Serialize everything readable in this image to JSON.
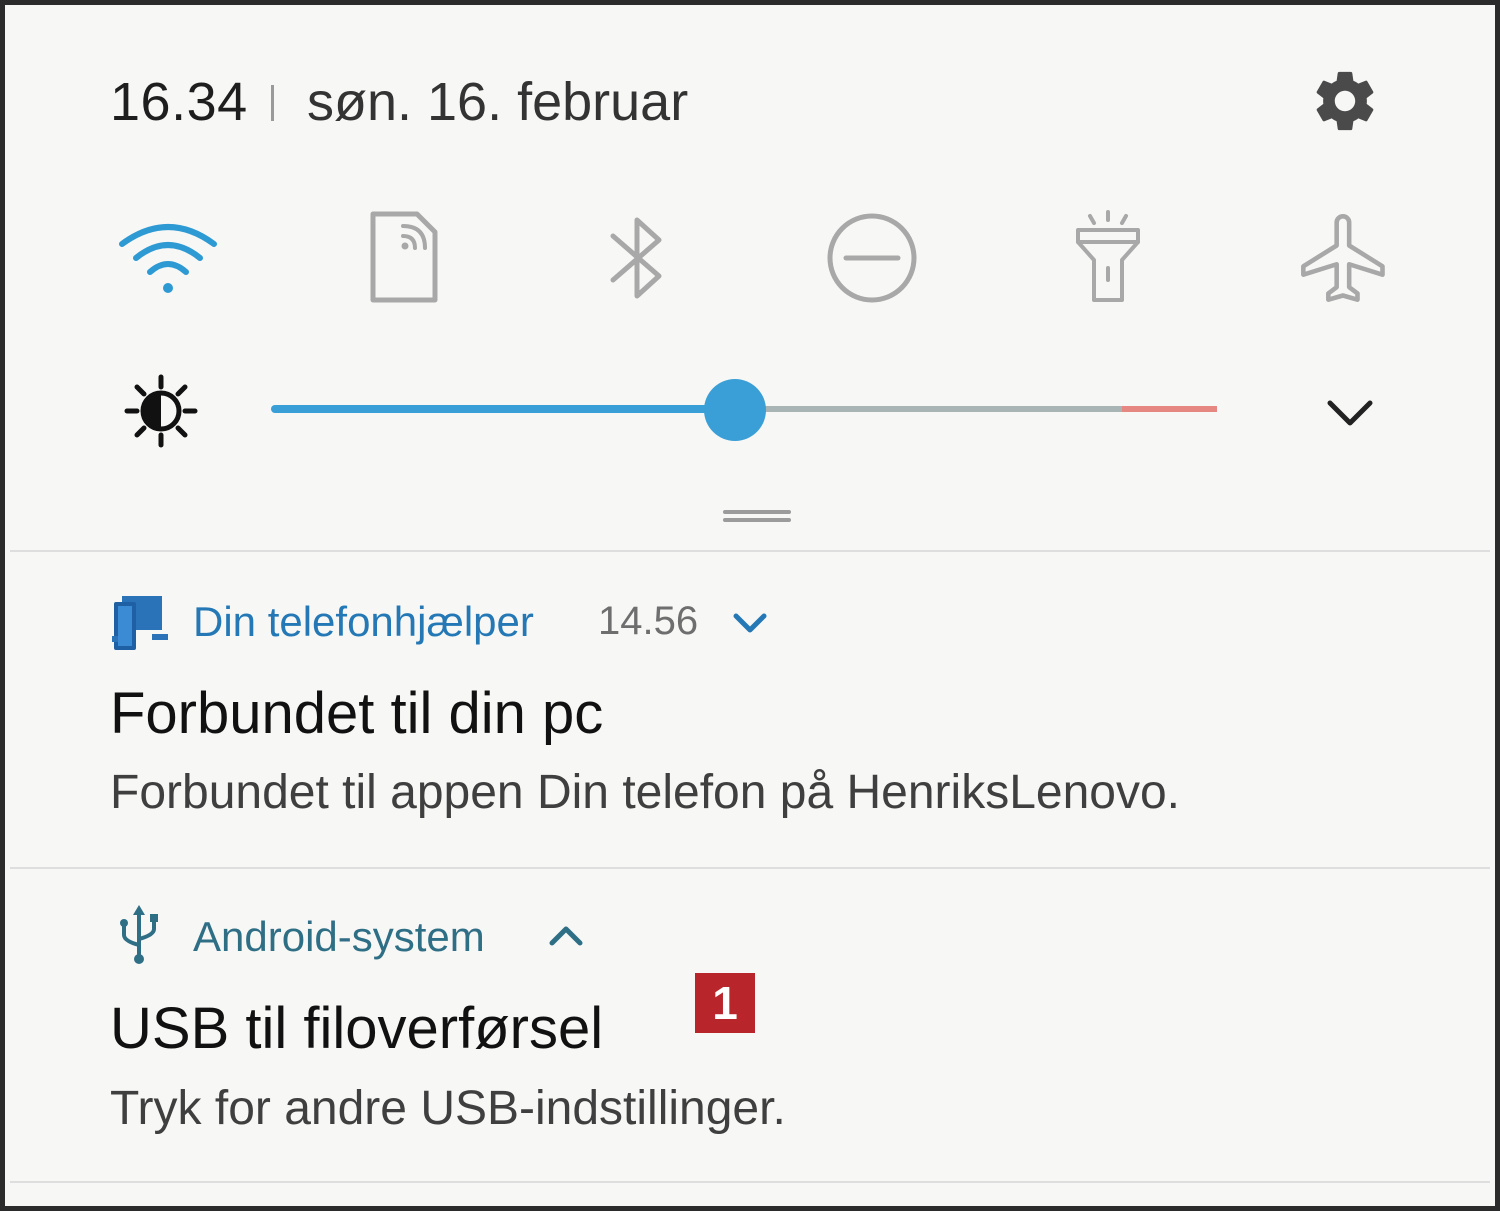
{
  "header": {
    "time": "16.34",
    "date": "søn. 16. februar",
    "settings_icon": "gear-icon"
  },
  "quick_toggles": [
    {
      "icon": "wifi-icon",
      "active": true,
      "color": "#2e9ad3"
    },
    {
      "icon": "nfc-icon",
      "active": false,
      "color": "#a6a6a6"
    },
    {
      "icon": "bluetooth-icon",
      "active": false,
      "color": "#a6a6a6"
    },
    {
      "icon": "do-not-disturb-icon",
      "active": false,
      "color": "#a6a6a6"
    },
    {
      "icon": "flashlight-icon",
      "active": false,
      "color": "#a6a6a6"
    },
    {
      "icon": "airplane-mode-icon",
      "active": false,
      "color": "#a6a6a6"
    }
  ],
  "brightness": {
    "icon": "brightness-icon",
    "level": 0.49,
    "accent": "#3a9fd6",
    "warning_color": "#e78782"
  },
  "notifications": [
    {
      "app_icon": "phone-link-icon",
      "app_name": "Din telefonhjælper",
      "time": "14.56",
      "chevron": "chevron-down-icon",
      "title": "Forbundet til din pc",
      "text": "Forbundet til appen Din telefon på HenriksLenovo."
    },
    {
      "app_icon": "usb-icon",
      "app_name": "Android-system",
      "chevron": "chevron-up-icon",
      "title": "USB til filoverførsel",
      "text": "Tryk for andre USB-indstillinger.",
      "badge": "1"
    }
  ]
}
